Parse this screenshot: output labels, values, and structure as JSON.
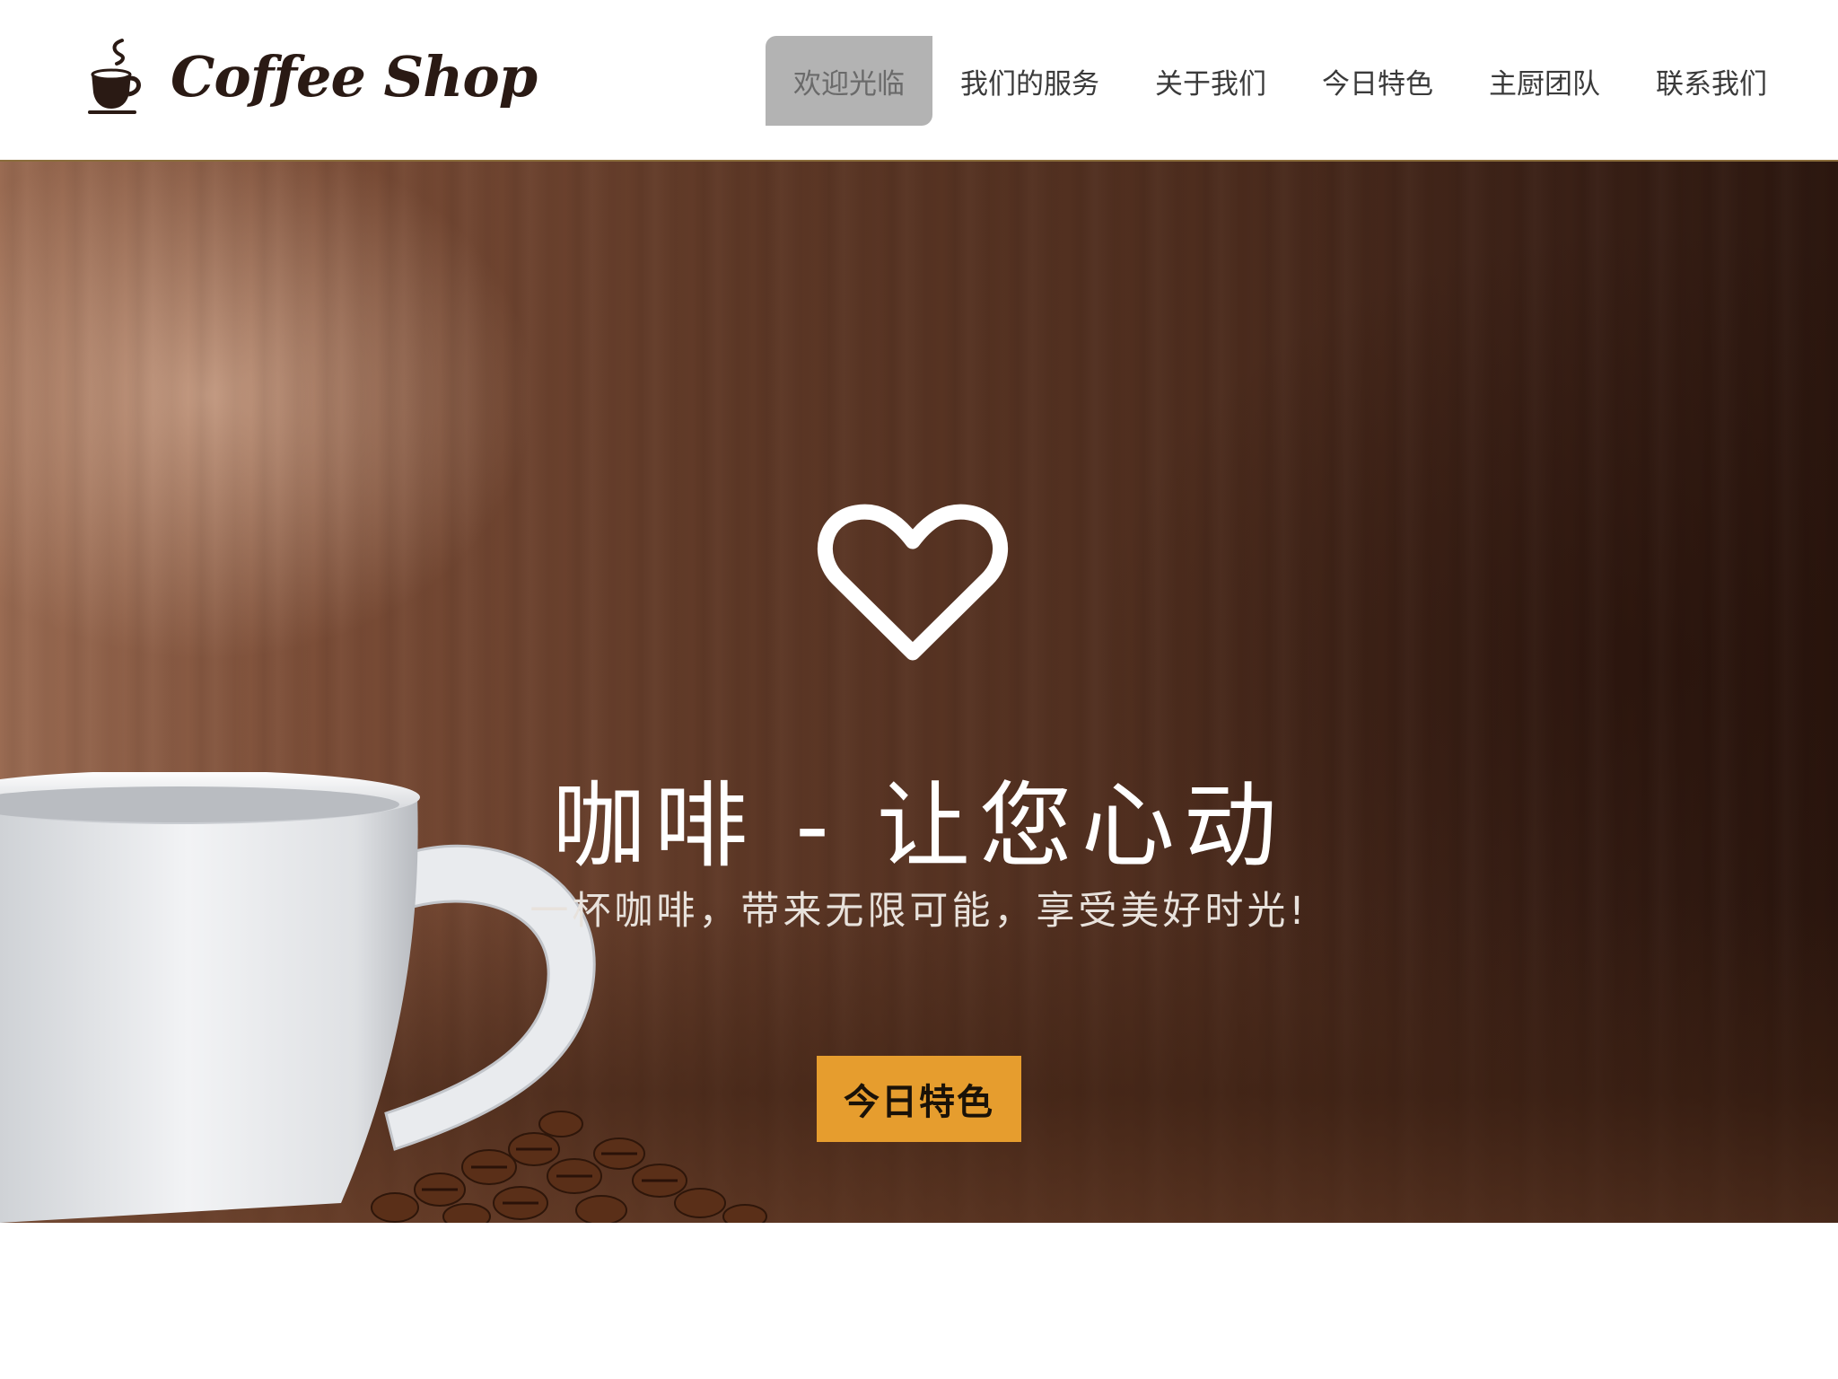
{
  "brand": {
    "name": "Coffee Shop",
    "logo_icon": "coffee-cup-icon"
  },
  "nav": {
    "items": [
      {
        "label": "欢迎光临",
        "active": true
      },
      {
        "label": "我们的服务",
        "active": false
      },
      {
        "label": "关于我们",
        "active": false
      },
      {
        "label": "今日特色",
        "active": false
      },
      {
        "label": "主厨团队",
        "active": false
      },
      {
        "label": "联系我们",
        "active": false
      }
    ]
  },
  "hero": {
    "icon": "heart-icon",
    "title": "咖啡 - 让您心动",
    "subtitle": "一杯咖啡，带来无限可能，享受美好时光!",
    "button_label": "今日特色"
  },
  "colors": {
    "accent": "#e69d2e",
    "nav_active_bg": "#b3b3b3",
    "header_border": "#8a6d3b",
    "logo_text": "#2a1a14"
  }
}
